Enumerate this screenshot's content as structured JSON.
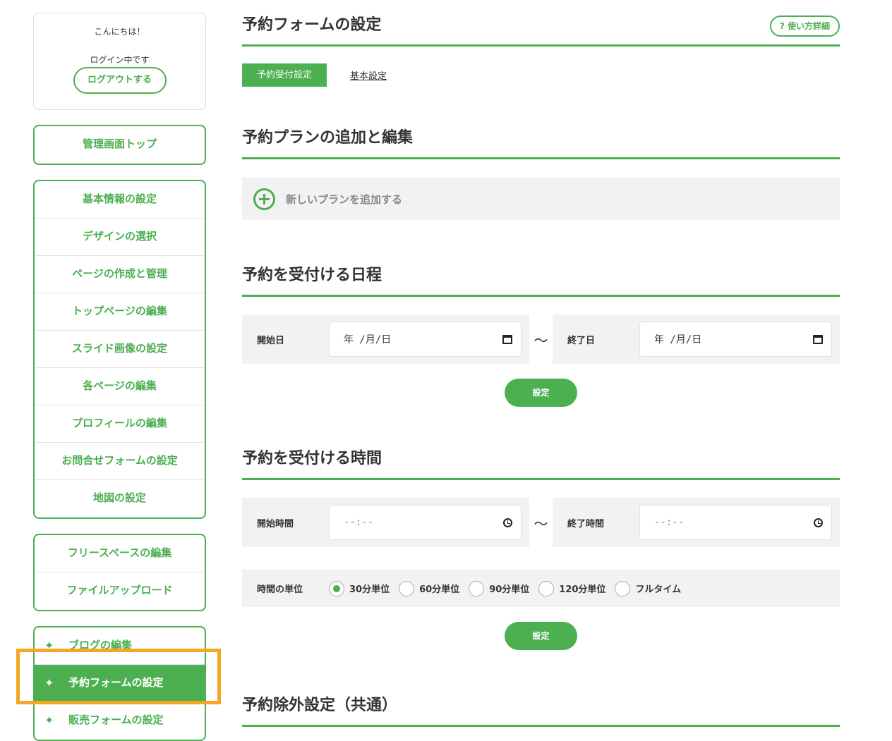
{
  "sidebar": {
    "greeting": "こんにちは！",
    "login_status": "ログイン中です",
    "logout_label": "ログアウトする",
    "top_item": "管理画面トップ",
    "group1": [
      "基本情報の設定",
      "デザインの選択",
      "ページの作成と管理",
      "トップページの編集",
      "スライド画像の設定",
      "各ページの編集",
      "プロフィールの編集",
      "お問合せフォームの設定",
      "地図の設定"
    ],
    "group2": [
      "フリースペースの編集",
      "ファイルアップロード"
    ],
    "group3": [
      "ブログの編集",
      "予約フォームの設定",
      "販売フォームの設定"
    ],
    "star_glyph": "✦"
  },
  "main": {
    "page_title": "予約フォームの設定",
    "help_label": "? 使い方詳細",
    "tabs": {
      "active": "予約受付設定",
      "other": "基本設定"
    },
    "plan_section": {
      "title": "予約プランの追加と編集",
      "add_label": "新しいプランを追加する"
    },
    "schedule_section": {
      "title": "予約を受付ける日程",
      "start_label": "開始日",
      "end_label": "終了日",
      "start_placeholder": "年 /月/日",
      "end_placeholder": "年 /月/日",
      "tilde": "〜",
      "set_label": "設定"
    },
    "time_section": {
      "title": "予約を受付ける時間",
      "start_label": "開始時間",
      "end_label": "終了時間",
      "start_placeholder": "--:--",
      "end_placeholder": "--:--",
      "tilde": "〜",
      "unit_label": "時間の単位",
      "units": [
        "30分単位",
        "60分単位",
        "90分単位",
        "120分単位",
        "フルタイム"
      ],
      "selected_unit": "30分単位",
      "set_label": "設定"
    },
    "exclude_section": {
      "title": "予約除外設定（共通）"
    }
  },
  "colors": {
    "accent": "#4caf50",
    "highlight": "#f5a623",
    "panel_bg": "#f2f2f2"
  }
}
